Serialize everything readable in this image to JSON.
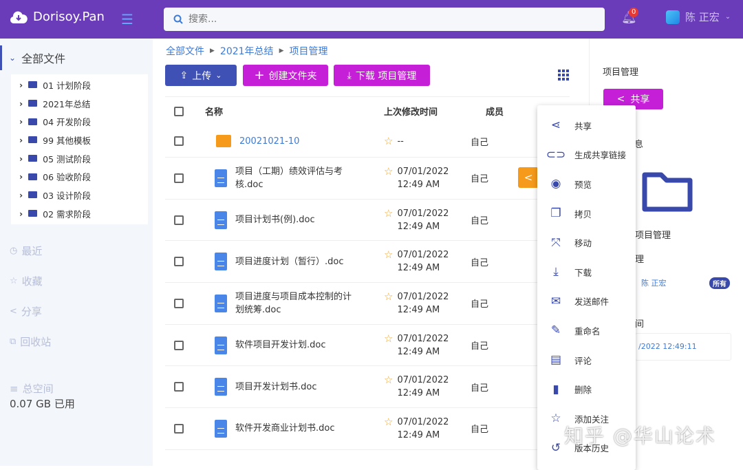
{
  "header": {
    "app_name": "Dorisoy.Pan",
    "search_placeholder": "搜索...",
    "notification_count": "0",
    "user_name": "陈 正宏"
  },
  "sidebar": {
    "root_label": "全部文件",
    "tree": [
      "01 计划阶段",
      "2021年总结",
      "04 开发阶段",
      "99 其他模板",
      "05 测试阶段",
      "06 验收阶段",
      "03 设计阶段",
      "02 需求阶段"
    ],
    "nav": [
      {
        "icon": "clock-icon",
        "label": "最近"
      },
      {
        "icon": "star-icon",
        "label": "收藏"
      },
      {
        "icon": "share-icon",
        "label": "分享"
      },
      {
        "icon": "recycle-icon",
        "label": "回收站"
      }
    ],
    "storage_label": "总空间",
    "storage_used": "0.07 GB 已用"
  },
  "breadcrumb": [
    "全部文件",
    "2021年总结",
    "项目管理"
  ],
  "toolbar": {
    "upload": "上传",
    "create_folder": "创建文件夹",
    "download": "下载 项目管理"
  },
  "table": {
    "headers": {
      "name": "名称",
      "modified": "上次修改时间",
      "members": "成员"
    },
    "rows": [
      {
        "type": "folder",
        "name": "20021021-10",
        "date": "--",
        "time": "",
        "members": "自己"
      },
      {
        "type": "doc",
        "name": "项目（工期）绩效评估与考核.doc",
        "date": "07/01/2022",
        "time": "12:49 AM",
        "members": "自己"
      },
      {
        "type": "doc",
        "name": "项目计划书(例).doc",
        "date": "07/01/2022",
        "time": "12:49 AM",
        "members": "自己"
      },
      {
        "type": "doc",
        "name": "项目进度计划（暂行）.doc",
        "date": "07/01/2022",
        "time": "12:49 AM",
        "members": "自己"
      },
      {
        "type": "doc",
        "name": "项目进度与项目成本控制的计划统筹.doc",
        "date": "07/01/2022",
        "time": "12:49 AM",
        "members": "自己"
      },
      {
        "type": "doc",
        "name": "软件项目开发计划.doc",
        "date": "07/01/2022",
        "time": "12:49 AM",
        "members": "自己"
      },
      {
        "type": "doc",
        "name": "项目开发计划书.doc",
        "date": "07/01/2022",
        "time": "12:49 AM",
        "members": "自己"
      },
      {
        "type": "doc",
        "name": "软件开发商业计划书.doc",
        "date": "07/01/2022",
        "time": "12:49 AM",
        "members": "自己"
      }
    ]
  },
  "panel": {
    "title": "项目管理",
    "share": "共享",
    "info_fragment": "息",
    "folder_name_fragment": "项目管理",
    "label_fragment": "理",
    "owner": "陈 正宏",
    "owner_badge": "所有",
    "time_label_fragment": "间",
    "time_fragment": "/2022 12:49:11"
  },
  "context_menu": [
    {
      "icon": "share-icon",
      "label": "共享"
    },
    {
      "icon": "link-icon",
      "label": "生成共享链接"
    },
    {
      "icon": "eye-icon",
      "label": "预览"
    },
    {
      "icon": "copy-icon",
      "label": "拷贝"
    },
    {
      "icon": "move-icon",
      "label": "移动"
    },
    {
      "icon": "download-icon",
      "label": "下载"
    },
    {
      "icon": "mail-icon",
      "label": "发送邮件"
    },
    {
      "icon": "pencil-icon",
      "label": "重命名"
    },
    {
      "icon": "comment-icon",
      "label": "评论"
    },
    {
      "icon": "trash-icon",
      "label": "删除"
    },
    {
      "icon": "star-icon",
      "label": "添加关注"
    },
    {
      "icon": "history-icon",
      "label": "版本历史"
    }
  ],
  "watermark": "知乎 @华山论术",
  "colors": {
    "topbar": "#6a3cb9",
    "primary": "#3f51b5",
    "magenta": "#c51fd8",
    "orange": "#f59a1b",
    "link": "#3d7ad6"
  }
}
